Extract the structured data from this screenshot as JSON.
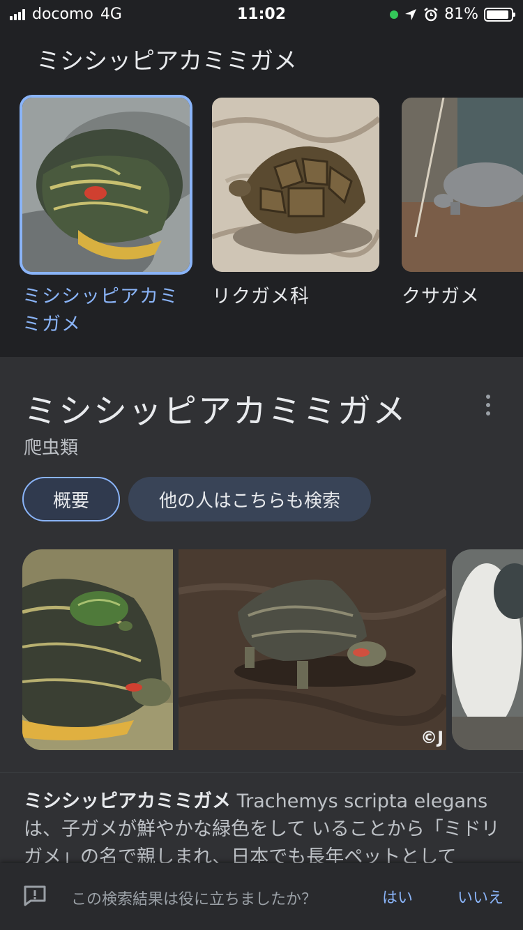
{
  "status": {
    "carrier": "docomo",
    "network": "4G",
    "time": "11:02",
    "battery": "81%"
  },
  "carousel": {
    "title": "ミシシッピアカミミガメ",
    "items": [
      {
        "label": "ミシシッピアカミミガメ",
        "selected": true
      },
      {
        "label": "リクガメ科",
        "selected": false
      },
      {
        "label": "クサガメ",
        "selected": false
      }
    ]
  },
  "knowledge_panel": {
    "title": "ミシシッピアカミミガメ",
    "subtitle": "爬虫類",
    "tabs": [
      {
        "label": "概要",
        "active": true
      },
      {
        "label": "他の人はこちらも検索",
        "active": false
      }
    ],
    "image_watermark": "©J",
    "description_bold": "ミシシッピアカミミガメ",
    "description_text": " Trachemys scripta elegans は、子ガメが鮮やかな緑色をして いることから「ミドリガメ」の名で親しまれ、日本でも長年ペットとして"
  },
  "feedback": {
    "question": "この検索結果は役に立ちましたか？",
    "yes": "はい",
    "no": "いいえ"
  },
  "colors": {
    "background": "#202124",
    "panel": "#303134",
    "accent": "#8ab4f8",
    "chip": "#394457"
  }
}
